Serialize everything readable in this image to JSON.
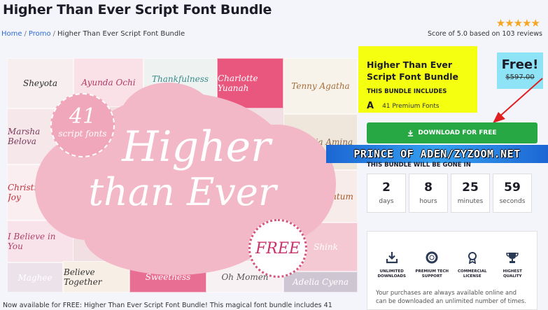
{
  "page": {
    "title": "Higher Than Ever Script Font Bundle"
  },
  "rating": {
    "stars": "★★★★★",
    "score_text": "Score of 5.0 based on 103 reviews"
  },
  "breadcrumb": {
    "home": "Home",
    "promo": "Promo",
    "current": "Higher Than Ever Script Font Bundle",
    "sep": "/"
  },
  "hero": {
    "headline_line1": "Higher",
    "headline_line2": "than Ever",
    "badge_number": "41",
    "badge_text": "script fonts",
    "free_seal": "FREE",
    "tiles": [
      "Sheyota",
      "Ayunda Ochi",
      "Thankfulness",
      "Charlotte Yuanah",
      "Tenny Agatha",
      "Marsha Belova",
      "Camalia Amina",
      "Christmas Joy",
      "Sain Centum",
      "I Believe in You",
      "Shink",
      "Maghee",
      "Believe Together",
      "Sweetness",
      "Oh Momen",
      "Adelia Cyena"
    ]
  },
  "bundle": {
    "title": "Higher Than Ever Script Font Bundle",
    "includes_label": "THIS BUNDLE INCLUDES",
    "fonts_icon": "A",
    "fonts_count": "41 Premium Fonts"
  },
  "price": {
    "free_label": "Free!",
    "old_price": "$597.00"
  },
  "download": {
    "label": "DOWNLOAD FOR FREE",
    "icon": "download-icon"
  },
  "watermark": {
    "text": "PRINCE OF ADEN/ZYZOOM.NET"
  },
  "countdown": {
    "label": "THIS BUNDLE WILL BE GONE IN",
    "items": [
      {
        "value": "2",
        "unit": "days"
      },
      {
        "value": "8",
        "unit": "hours"
      },
      {
        "value": "25",
        "unit": "minutes"
      },
      {
        "value": "59",
        "unit": "seconds"
      }
    ]
  },
  "features": {
    "items": [
      {
        "icon": "download-tray-icon",
        "label": "UNLIMITED DOWNLOADS"
      },
      {
        "icon": "lifebuoy-icon",
        "label": "PREMIUM TECH SUPPORT"
      },
      {
        "icon": "award-ribbon-icon",
        "label": "COMMERCIAL LICENSE"
      },
      {
        "icon": "trophy-icon",
        "label": "HIGHEST QUALITY"
      }
    ],
    "note": "Your purchases are always available online and can be downloaded an unlimited number of times."
  },
  "description": {
    "text": "Now available for FREE: Higher Than Ever Script Font Bundle! This magical font bundle includes 41"
  },
  "colors": {
    "download_green": "#28a745",
    "info_yellow": "#f5ff10",
    "free_cyan": "#8fe3f7",
    "arrow_red": "#e02020",
    "hero_pink": "#f2b8c8"
  }
}
